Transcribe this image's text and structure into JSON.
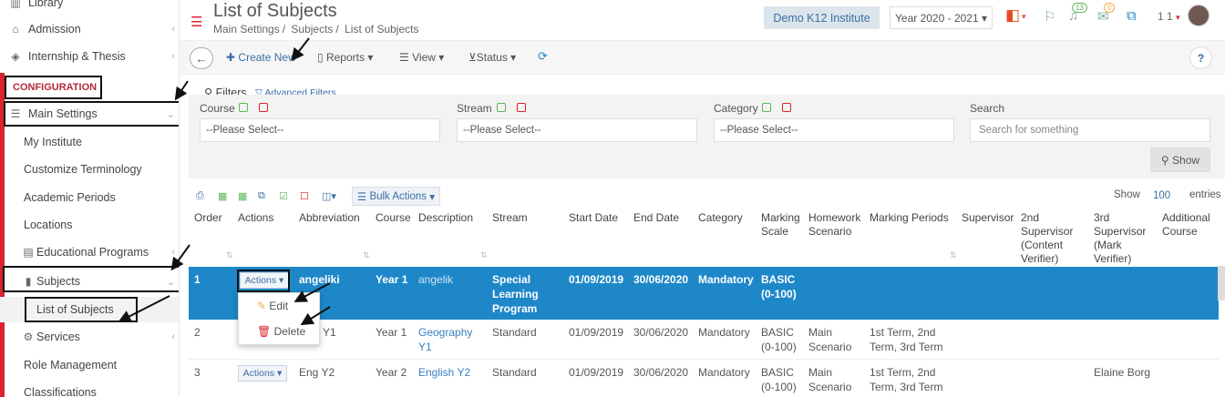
{
  "sidebar": {
    "items": {
      "library": "Library",
      "admission": "Admission",
      "internship": "Internship & Thesis",
      "configuration": "CONFIGURATION",
      "main_settings": "Main Settings",
      "my_institute": "My Institute",
      "customize": "Customize Terminology",
      "academic_periods": "Academic Periods",
      "locations": "Locations",
      "educational_programs": "Educational Programs",
      "subjects": "Subjects",
      "list_of_subjects": "List of Subjects",
      "services": "Services",
      "role_management": "Role Management",
      "classifications": "Classifications"
    }
  },
  "header": {
    "title": "List of Subjects",
    "breadcrumb": [
      "Main Settings",
      "Subjects",
      "List of Subjects"
    ],
    "institute": "Demo K12 Institute",
    "year": "Year 2020 - 2021",
    "notif_count": "13",
    "msg_count": "0",
    "user": "1 1"
  },
  "toolbar": {
    "create_new": "Create New",
    "reports": "Reports",
    "view": "View",
    "status": "Status",
    "help": "?"
  },
  "filters": {
    "label": "Filters",
    "advanced": "Advanced Filters",
    "course_label": "Course",
    "stream_label": "Stream",
    "category_label": "Category",
    "search_label": "Search",
    "course_value": "--Please Select--",
    "stream_value": "--Please Select--",
    "category_value": "--Please Select--",
    "search_placeholder": "Search for something",
    "show_button": "Show"
  },
  "grid": {
    "bulk_actions": "Bulk Actions",
    "show_label": "Show",
    "show_value": "100",
    "entries_label": "entries",
    "columns": {
      "order": "Order",
      "actions": "Actions",
      "abbreviation": "Abbreviation",
      "course": "Course",
      "description": "Description",
      "stream": "Stream",
      "start_date": "Start Date",
      "end_date": "End Date",
      "category": "Category",
      "marking_scale": "Marking Scale",
      "homework": "Homework Scenario",
      "marking_periods": "Marking Periods",
      "supervisor": "Supervisor",
      "supervisor2": "2nd Supervisor (Content Verifier)",
      "supervisor3": "3rd Supervisor (Mark Verifier)",
      "additional_course": "Additional Course"
    },
    "actions_label": "Actions",
    "dropdown": {
      "edit": "Edit",
      "delete": "Delete"
    },
    "rows": [
      {
        "order": "1",
        "abbr": "angeliki",
        "course": "Year 1",
        "desc": "angelik",
        "stream": "Special Learning Program",
        "start": "01/09/2019",
        "end": "30/06/2020",
        "category": "Mandatory",
        "scale": "BASIC (0-100)",
        "homework": "",
        "periods": "",
        "sup2": ""
      },
      {
        "order": "2",
        "abbr": "Y1",
        "course": "Year 1",
        "desc": "Geography Y1",
        "stream": "Standard",
        "start": "01/09/2019",
        "end": "30/06/2020",
        "category": "Mandatory",
        "scale": "BASIC (0-100)",
        "homework": "Main Scenario",
        "periods": "1st Term, 2nd Term, 3rd Term",
        "sup2": ""
      },
      {
        "order": "3",
        "abbr": "Eng Y2",
        "course": "Year 2",
        "desc": "English Y2",
        "stream": "Standard",
        "start": "01/09/2019",
        "end": "30/06/2020",
        "category": "Mandatory",
        "scale": "BASIC (0-100)",
        "homework": "Main Scenario",
        "periods": "1st Term, 2nd Term, 3rd Term",
        "sup2": "Elaine Borg"
      }
    ]
  }
}
